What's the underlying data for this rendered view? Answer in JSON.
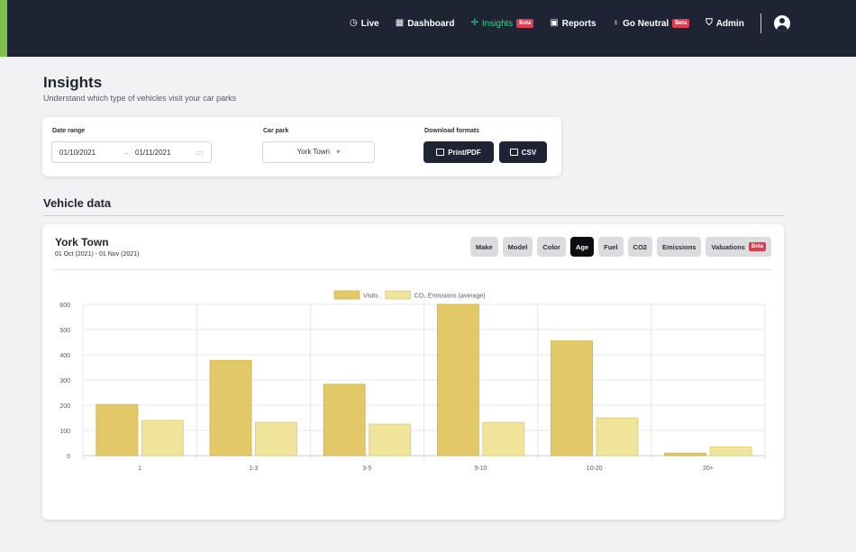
{
  "nav": {
    "live": "Live",
    "dashboard": "Dashboard",
    "insights": "Insights",
    "reports": "Reports",
    "go_neutral": "Go Neutral",
    "admin": "Admin",
    "beta": "Beta"
  },
  "header": {
    "title": "Insights",
    "subtitle": "Understand which type of vehicles visit your car parks"
  },
  "filters": {
    "date_range_label": "Date range",
    "date_from": "01/10/2021",
    "date_arrow": "→",
    "date_to": "01/11/2021",
    "car_park_label": "Car park",
    "car_park_value": "York Town",
    "download_label": "Download formats",
    "print_pdf": "Print/PDF",
    "csv": "CSV"
  },
  "section": {
    "title": "Vehicle data"
  },
  "card": {
    "title": "York Town",
    "date_range": "01 Oct (2021) - 01 Nov (2021)",
    "tabs": [
      "Make",
      "Model",
      "Color",
      "Age",
      "Fuel",
      "CO2",
      "Emissions",
      "Valuations"
    ],
    "active_tab": "Age",
    "beta": "Beta"
  },
  "colors": {
    "visits": "#e3c868",
    "co2": "#f0e49a",
    "nav_bg": "#1f2435",
    "nav_active": "#3fce86",
    "beta": "#e23a4c"
  },
  "chart_data": {
    "type": "bar",
    "categories": [
      "1",
      "1-3",
      "3-5",
      "5-10",
      "10-20",
      "20+"
    ],
    "series": [
      {
        "name": "Visits",
        "values": [
          203,
          378,
          283,
          600,
          455,
          10
        ]
      },
      {
        "name": "CO₂ Emissions (average)",
        "values": [
          140,
          132,
          125,
          132,
          150,
          35
        ]
      }
    ],
    "ylim": [
      0,
      600
    ],
    "yticks": [
      0,
      100,
      200,
      300,
      400,
      500,
      600
    ],
    "legend": "top-center",
    "grid": true
  }
}
